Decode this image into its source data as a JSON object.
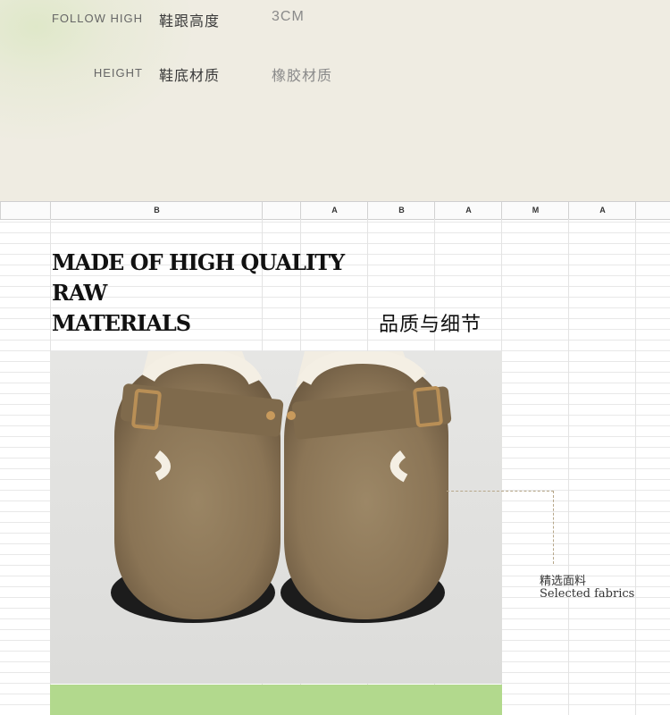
{
  "specs": [
    {
      "en": "FOLLOW HIGH",
      "cn": "鞋跟高度",
      "value": "3CM"
    },
    {
      "en": "HEIGHT",
      "cn": "鞋底材质",
      "value": "橡胶材质"
    }
  ],
  "sheet": {
    "columns": [
      "",
      "B",
      "",
      "A",
      "B",
      "A",
      "M",
      "A",
      ""
    ]
  },
  "headline": {
    "line1": "MADE OF HIGH QUALITY",
    "line2": "RAW",
    "line3": "MATERIALS"
  },
  "cn_title": "品质与细节",
  "callout": {
    "cn": "精选面料",
    "en": "Selected fabrics"
  },
  "colors": {
    "accent_green": "#b2d98d",
    "suede": "#8f7a5c",
    "band": "#efece2"
  }
}
